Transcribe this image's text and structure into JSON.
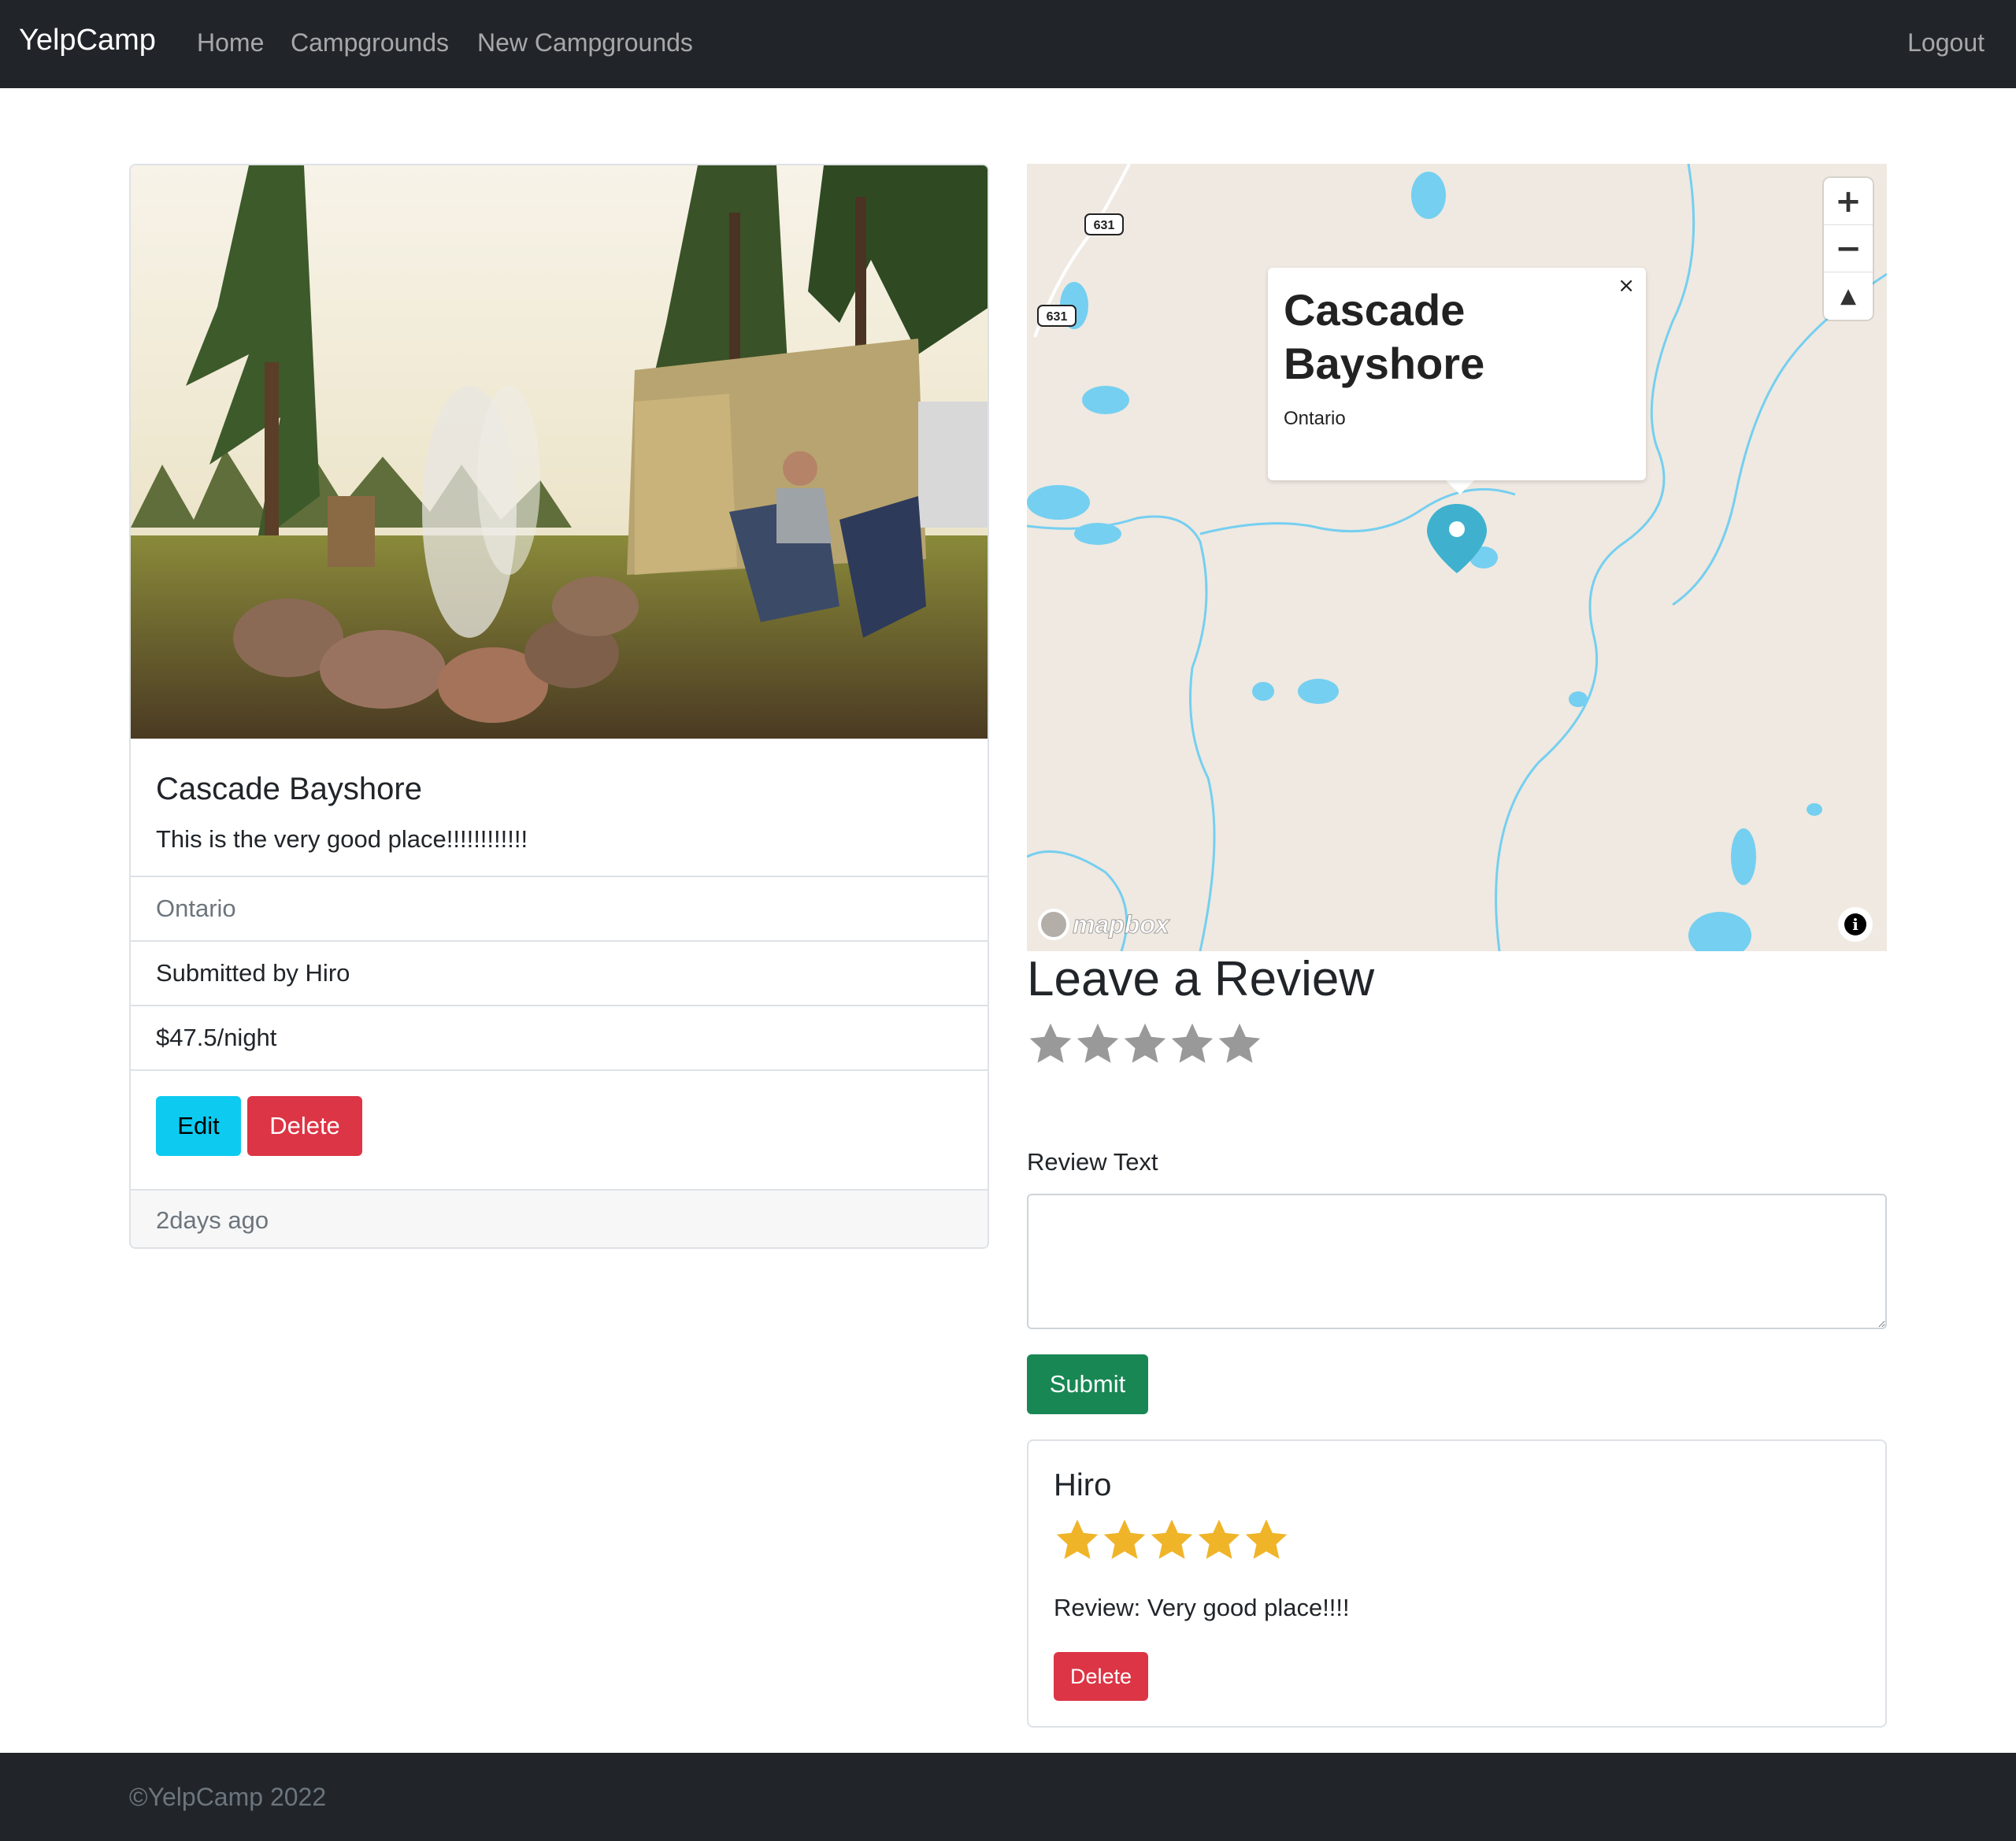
{
  "navbar": {
    "brand": "YelpCamp",
    "links": [
      "Home",
      "Campgrounds",
      "New Campgrounds"
    ],
    "logout": "Logout"
  },
  "campground": {
    "title": "Cascade Bayshore",
    "description": "This is the very good place!!!!!!!!!!!!",
    "location": "Ontario",
    "submitted_by": "Submitted by Hiro",
    "price": "$47.5/night",
    "edit_label": "Edit",
    "delete_label": "Delete",
    "posted": "2days ago"
  },
  "map": {
    "popup_title": "Cascade Bayshore",
    "popup_location": "Ontario",
    "popup_close": "×",
    "zoom_in": "+",
    "zoom_out": "−",
    "compass": "▲",
    "road_label": "631",
    "attribution_logo": "mapbox",
    "info": "i",
    "colors": {
      "land": "#efe9e1",
      "water": "#75cff0",
      "marker": "#3fb1ce"
    }
  },
  "review_form": {
    "heading": "Leave a Review",
    "rating_max": 5,
    "rating_value": 0,
    "text_label": "Review Text",
    "text_value": "",
    "submit_label": "Submit"
  },
  "reviews": [
    {
      "author": "Hiro",
      "rating": 5,
      "text": "Review: Very good place!!!!",
      "delete_label": "Delete"
    }
  ],
  "footer": {
    "text": "©YelpCamp 2022"
  },
  "colors": {
    "navbar": "#212529",
    "star_empty": "#999999",
    "star_filled": "#f0b429",
    "info": "#0dcaf0",
    "danger": "#dc3545",
    "success": "#198754"
  }
}
